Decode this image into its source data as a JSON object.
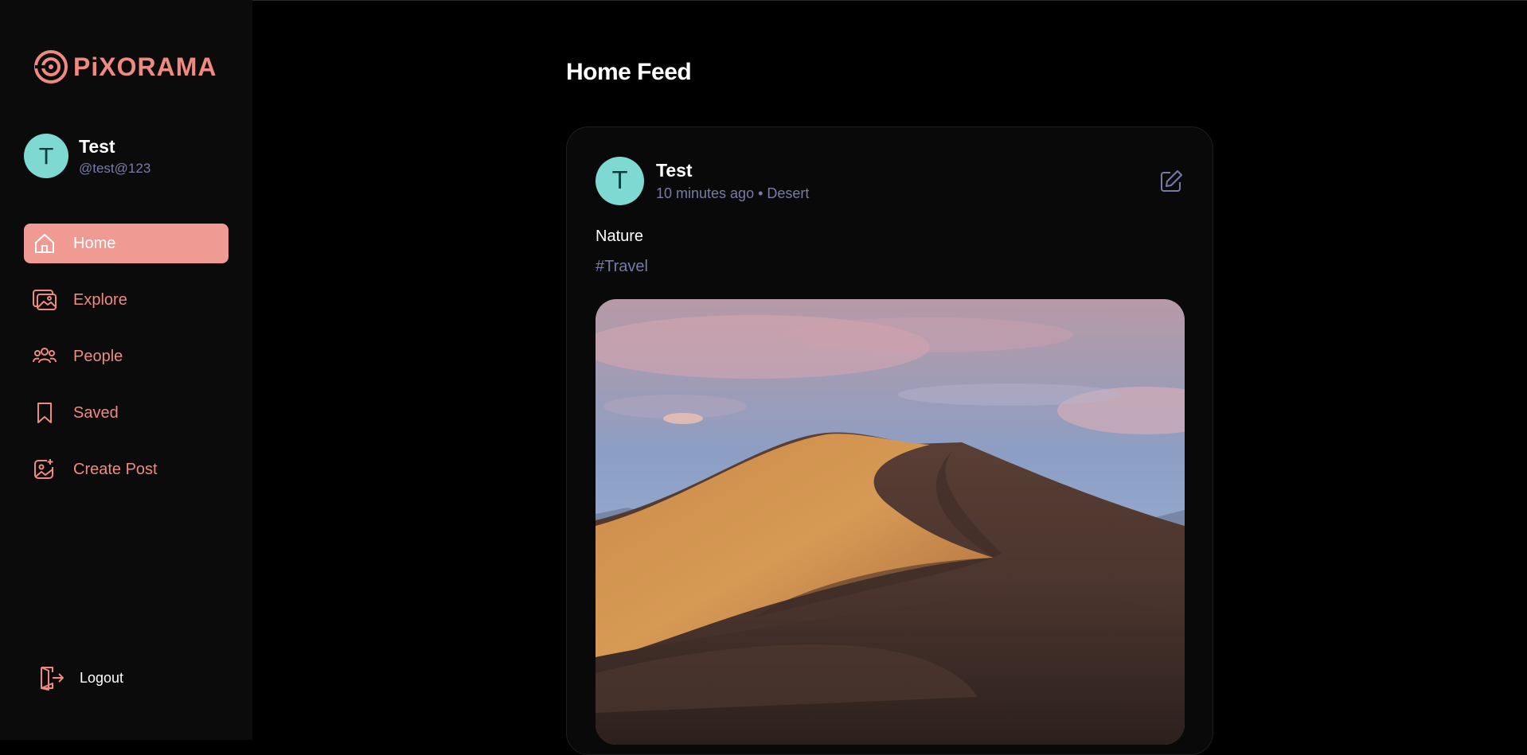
{
  "app": {
    "name": "PiXORAMA",
    "brand_color": "#ef8a80",
    "accent_teal": "#7ed9d2"
  },
  "user": {
    "avatar_letter": "T",
    "name": "Test",
    "handle": "@test@123"
  },
  "sidebar": {
    "items": [
      {
        "label": "Home",
        "icon": "home-icon",
        "active": true
      },
      {
        "label": "Explore",
        "icon": "gallery-icon",
        "active": false
      },
      {
        "label": "People",
        "icon": "people-icon",
        "active": false
      },
      {
        "label": "Saved",
        "icon": "bookmark-icon",
        "active": false
      },
      {
        "label": "Create Post",
        "icon": "image-add-icon",
        "active": false
      }
    ],
    "logout_label": "Logout"
  },
  "main": {
    "title": "Home Feed",
    "posts": [
      {
        "author_avatar_letter": "T",
        "author": "Test",
        "meta": "10 minutes ago • Desert",
        "caption": "Nature",
        "tags": "#Travel",
        "image": "desert-dune-photo"
      }
    ]
  }
}
